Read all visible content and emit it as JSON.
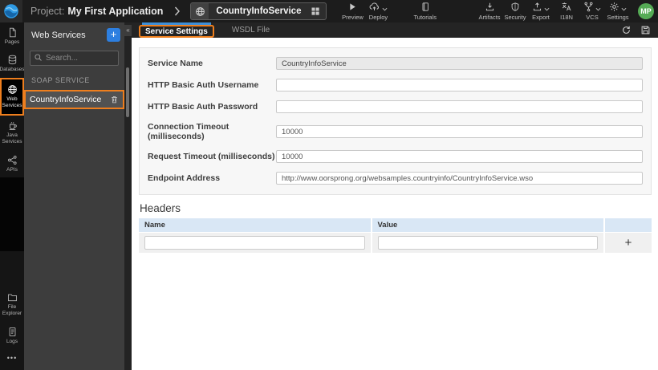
{
  "colors": {
    "annotation_highlight": "#ee7e1d",
    "active_tab_indicator": "#3e8ed6",
    "add_button_blue": "#2d7fe0",
    "avatar_green": "#55ab55",
    "table_header_blue": "#d9e7f5"
  },
  "topbar": {
    "project_label": "Project:",
    "project_name": "My First Application",
    "service_tab_label": "CountryInfoService",
    "preview_label": "Preview",
    "deploy_label": "Deploy",
    "tutorials_label": "Tutorials",
    "artifacts_label": "Artifacts",
    "security_label": "Security",
    "export_label": "Export",
    "i18n_label": "I18N",
    "vcs_label": "VCS",
    "settings_label": "Settings",
    "avatar_initials": "MP"
  },
  "sidebar": {
    "items": [
      {
        "label": "Pages"
      },
      {
        "label": "Databases"
      },
      {
        "label": "Web Services"
      },
      {
        "label": "Java Services"
      },
      {
        "label": "APIs"
      }
    ],
    "bottom_items": [
      {
        "label": "File Explorer"
      },
      {
        "label": "Logs"
      }
    ],
    "more_glyph": "•••"
  },
  "panel": {
    "title": "Web Services",
    "add_glyph": "+",
    "search_placeholder": "Search...",
    "section_label": "SOAP SERVICE",
    "service_item": "CountryInfoService",
    "collapse_glyph": "«"
  },
  "content": {
    "tabs": [
      {
        "label": "Service Settings"
      },
      {
        "label": "WSDL File"
      }
    ],
    "form": {
      "fields": [
        {
          "label": "Service Name",
          "value": "CountryInfoService"
        },
        {
          "label": "HTTP Basic Auth Username",
          "value": ""
        },
        {
          "label": "HTTP Basic Auth Password",
          "value": ""
        },
        {
          "label": "Connection Timeout (milliseconds)",
          "value": "10000"
        },
        {
          "label": "Request Timeout (milliseconds)",
          "value": "10000"
        },
        {
          "label": "Endpoint Address",
          "value": "http://www.oorsprong.org/websamples.countryinfo/CountryInfoService.wso"
        }
      ]
    },
    "headers": {
      "title": "Headers",
      "columns": [
        "Name",
        "Value"
      ],
      "add_glyph": "+"
    }
  }
}
